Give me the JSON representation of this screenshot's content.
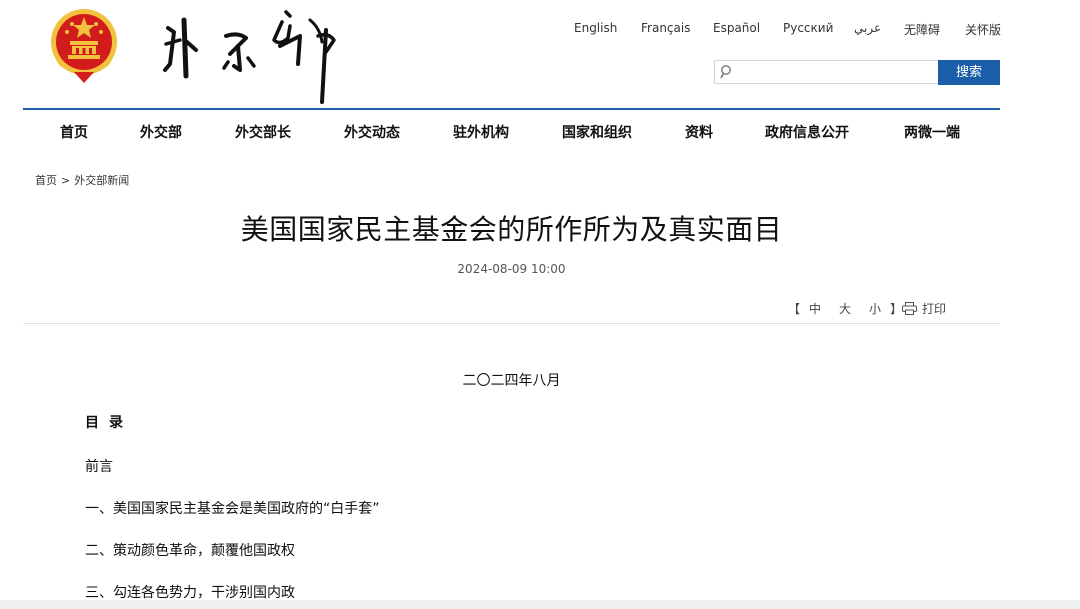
{
  "header": {
    "emblem_icon": "national-emblem-icon",
    "calligraphy_icon": "ministry-calligraphy-logo",
    "languages": [
      "English",
      "Français",
      "Español",
      "Русский",
      "عربي",
      "无障碍",
      "关怀版"
    ],
    "search": {
      "placeholder": "",
      "value": "",
      "button_label": "搜索"
    }
  },
  "nav": {
    "items": [
      "首页",
      "外交部",
      "外交部长",
      "外交动态",
      "驻外机构",
      "国家和组织",
      "资料",
      "政府信息公开",
      "两微一端"
    ]
  },
  "breadcrumb": {
    "home": "首页",
    "sep": ">",
    "section": "外交部新闻"
  },
  "article": {
    "title": "美国国家民主基金会的所作所为及真实面目",
    "date": "2024-08-09 10:00",
    "font_size": {
      "open": "【",
      "large": "中",
      "medium": "大",
      "small": "小",
      "close": "】"
    },
    "print_label": "打印",
    "subdate": "二〇二四年八月",
    "toc_heading": "目录",
    "toc": [
      "前言",
      "一、美国国家民主基金会是美国政府的“白手套”",
      "二、策动颜色革命，颠覆他国政权",
      "三、勾连各色势力，干涉别国内政"
    ]
  },
  "colors": {
    "nav_rule": "#1f5fa6",
    "search_button": "#1a5da8",
    "emblem_red": "#d21c1c",
    "emblem_gold": "#f3c23c"
  }
}
